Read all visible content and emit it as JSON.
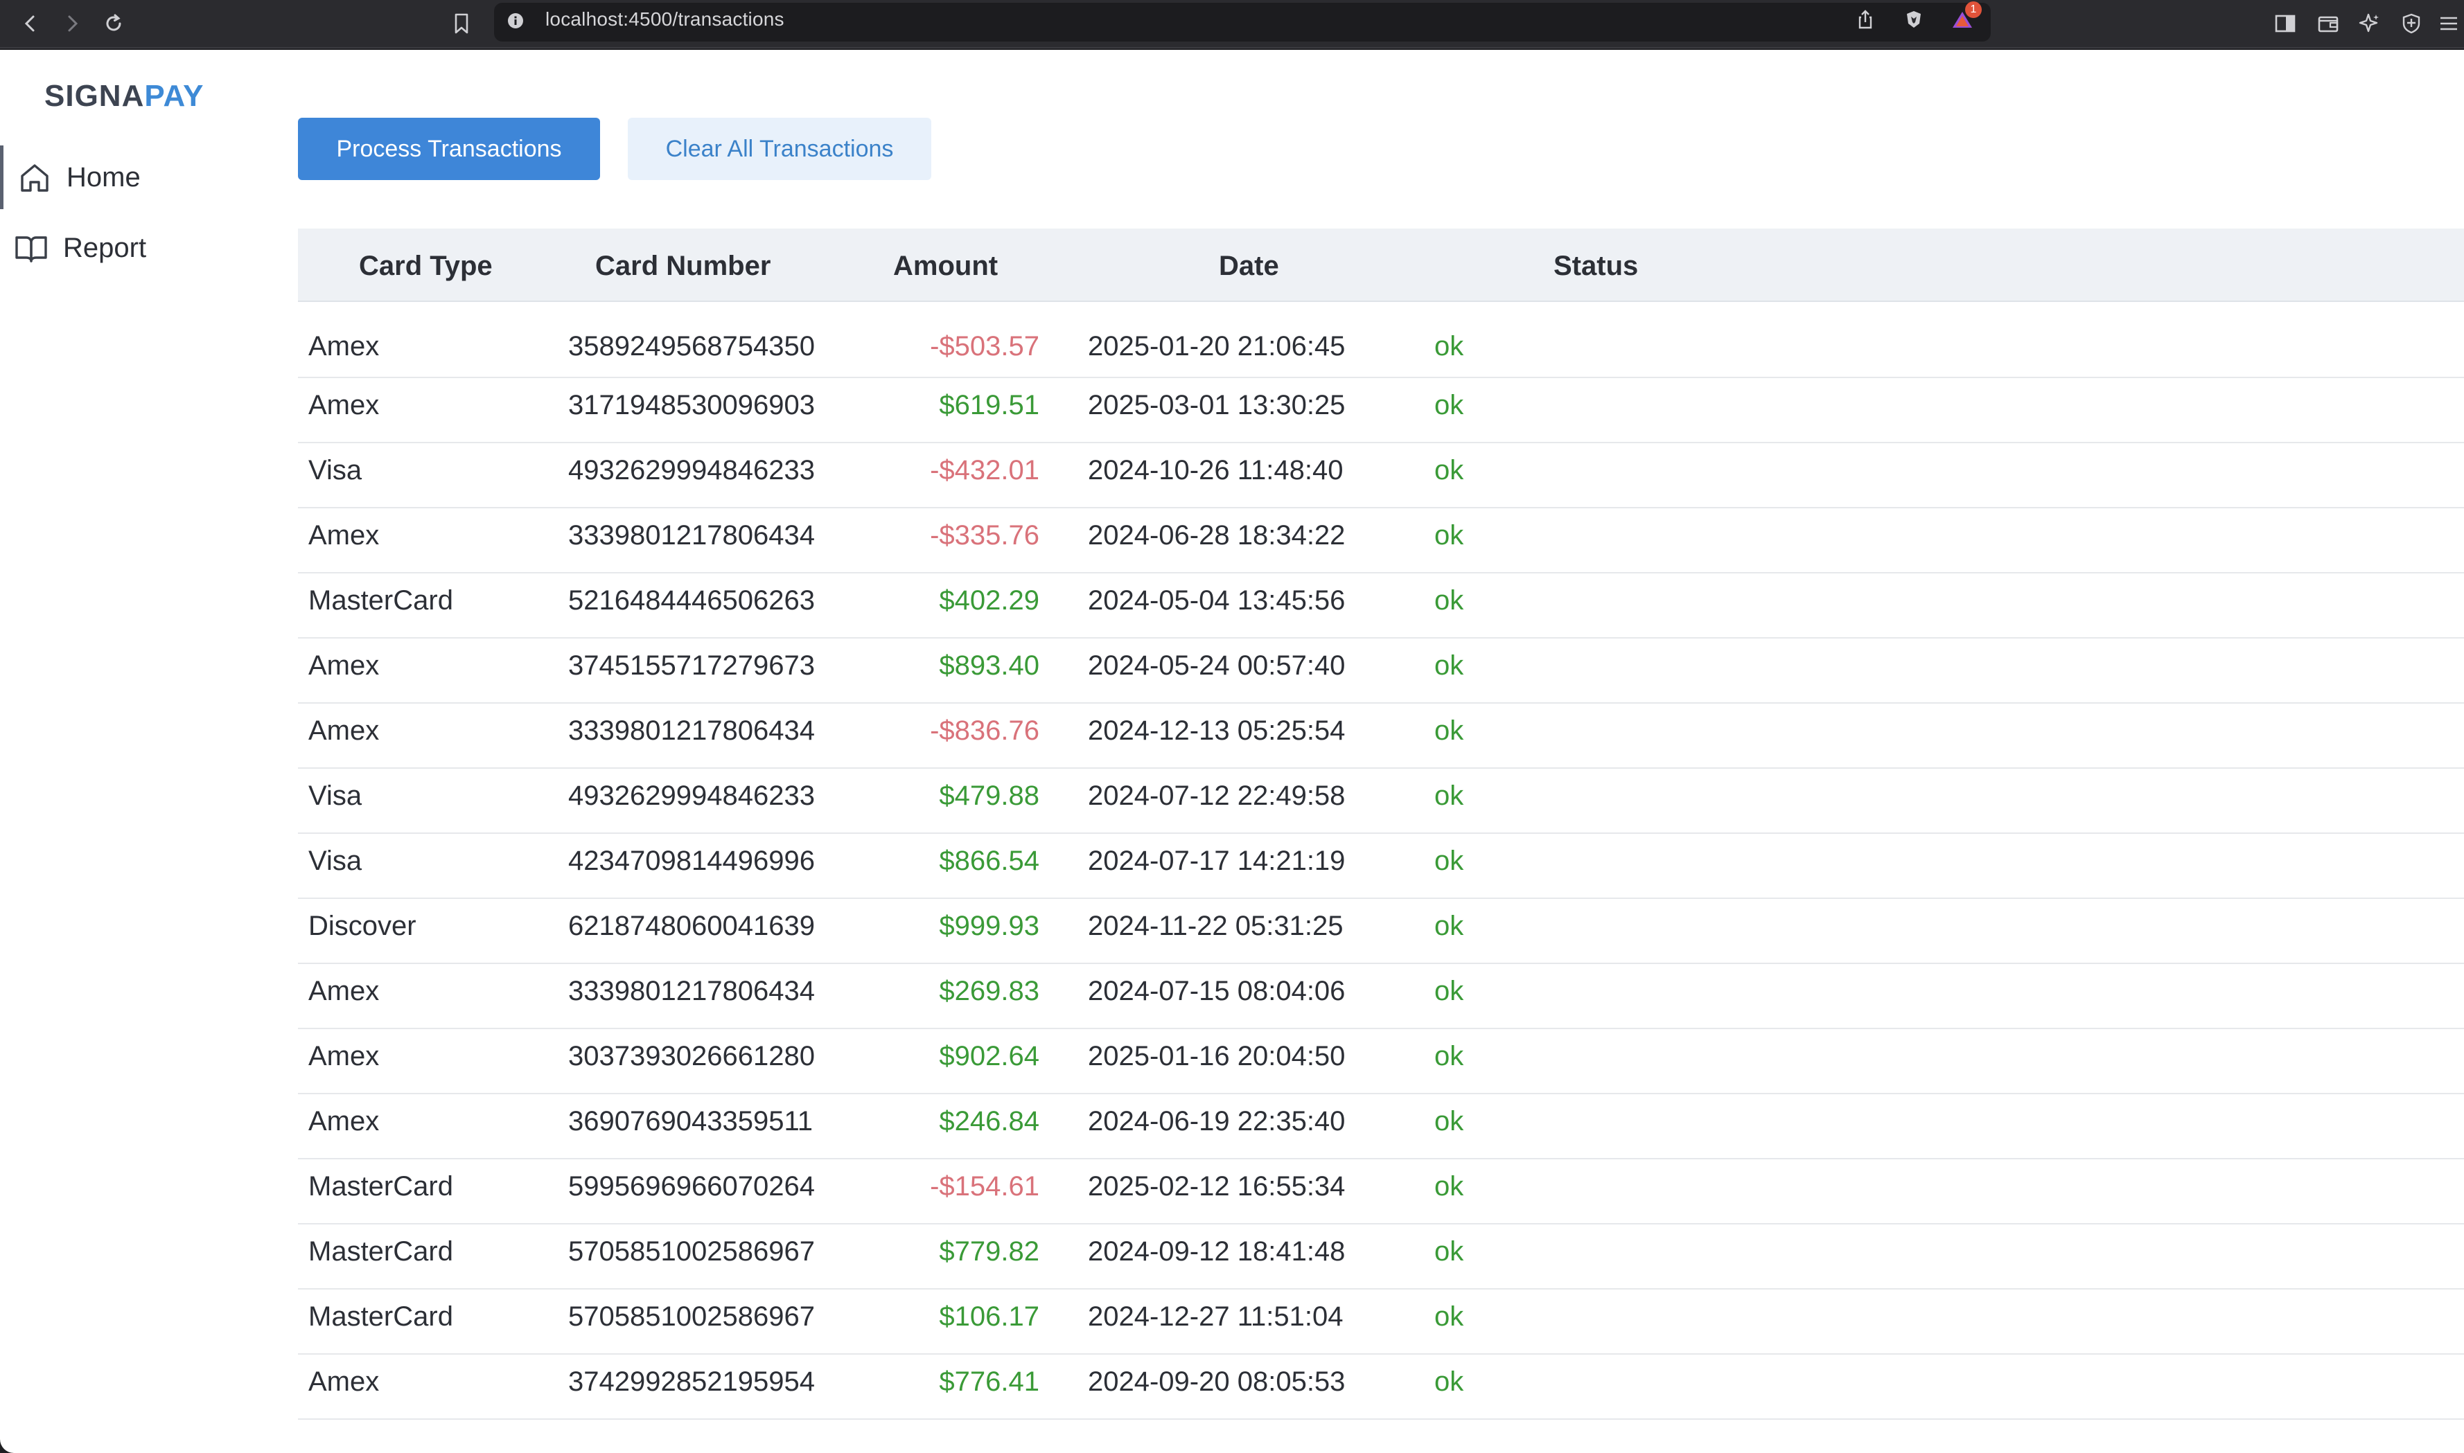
{
  "browser": {
    "url": "localhost:4500/transactions",
    "notification_count": "1"
  },
  "sidebar": {
    "logo_dark": "SIGNA",
    "logo_light": "PAY",
    "items": [
      {
        "label": "Home",
        "icon": "home-icon",
        "active": true
      },
      {
        "label": "Report",
        "icon": "book-icon",
        "active": false
      }
    ]
  },
  "toolbar": {
    "process_label": "Process Transactions",
    "clear_label": "Clear All Transactions"
  },
  "table": {
    "headers": [
      "Card Type",
      "Card Number",
      "Amount",
      "Date",
      "Status"
    ],
    "rows": [
      {
        "card_type": "Amex",
        "card_number": "3589249568754350",
        "amount": "-$503.57",
        "date": "2025-01-20 21:06:45",
        "status": "ok"
      },
      {
        "card_type": "Amex",
        "card_number": "3171948530096903",
        "amount": "$619.51",
        "date": "2025-03-01 13:30:25",
        "status": "ok"
      },
      {
        "card_type": "Visa",
        "card_number": "4932629994846233",
        "amount": "-$432.01",
        "date": "2024-10-26 11:48:40",
        "status": "ok"
      },
      {
        "card_type": "Amex",
        "card_number": "3339801217806434",
        "amount": "-$335.76",
        "date": "2024-06-28 18:34:22",
        "status": "ok"
      },
      {
        "card_type": "MasterCard",
        "card_number": "5216484446506263",
        "amount": "$402.29",
        "date": "2024-05-04 13:45:56",
        "status": "ok"
      },
      {
        "card_type": "Amex",
        "card_number": "3745155717279673",
        "amount": "$893.40",
        "date": "2024-05-24 00:57:40",
        "status": "ok"
      },
      {
        "card_type": "Amex",
        "card_number": "3339801217806434",
        "amount": "-$836.76",
        "date": "2024-12-13 05:25:54",
        "status": "ok"
      },
      {
        "card_type": "Visa",
        "card_number": "4932629994846233",
        "amount": "$479.88",
        "date": "2024-07-12 22:49:58",
        "status": "ok"
      },
      {
        "card_type": "Visa",
        "card_number": "4234709814496996",
        "amount": "$866.54",
        "date": "2024-07-17 14:21:19",
        "status": "ok"
      },
      {
        "card_type": "Discover",
        "card_number": "6218748060041639",
        "amount": "$999.93",
        "date": "2024-11-22 05:31:25",
        "status": "ok"
      },
      {
        "card_type": "Amex",
        "card_number": "3339801217806434",
        "amount": "$269.83",
        "date": "2024-07-15 08:04:06",
        "status": "ok"
      },
      {
        "card_type": "Amex",
        "card_number": "3037393026661280",
        "amount": "$902.64",
        "date": "2025-01-16 20:04:50",
        "status": "ok"
      },
      {
        "card_type": "Amex",
        "card_number": "3690769043359511",
        "amount": "$246.84",
        "date": "2024-06-19 22:35:40",
        "status": "ok"
      },
      {
        "card_type": "MasterCard",
        "card_number": "5995696966070264",
        "amount": "-$154.61",
        "date": "2025-02-12 16:55:34",
        "status": "ok"
      },
      {
        "card_type": "MasterCard",
        "card_number": "5705851002586967",
        "amount": "$779.82",
        "date": "2024-09-12 18:41:48",
        "status": "ok"
      },
      {
        "card_type": "MasterCard",
        "card_number": "5705851002586967",
        "amount": "$106.17",
        "date": "2024-12-27 11:51:04",
        "status": "ok"
      },
      {
        "card_type": "Amex",
        "card_number": "3742992852195954",
        "amount": "$776.41",
        "date": "2024-09-20 08:05:53",
        "status": "ok"
      }
    ]
  },
  "colors": {
    "primary": "#3e86d8",
    "negative_amount": "#d9727a",
    "positive_amount": "#3a9a37",
    "status_ok": "#3a9a37"
  }
}
